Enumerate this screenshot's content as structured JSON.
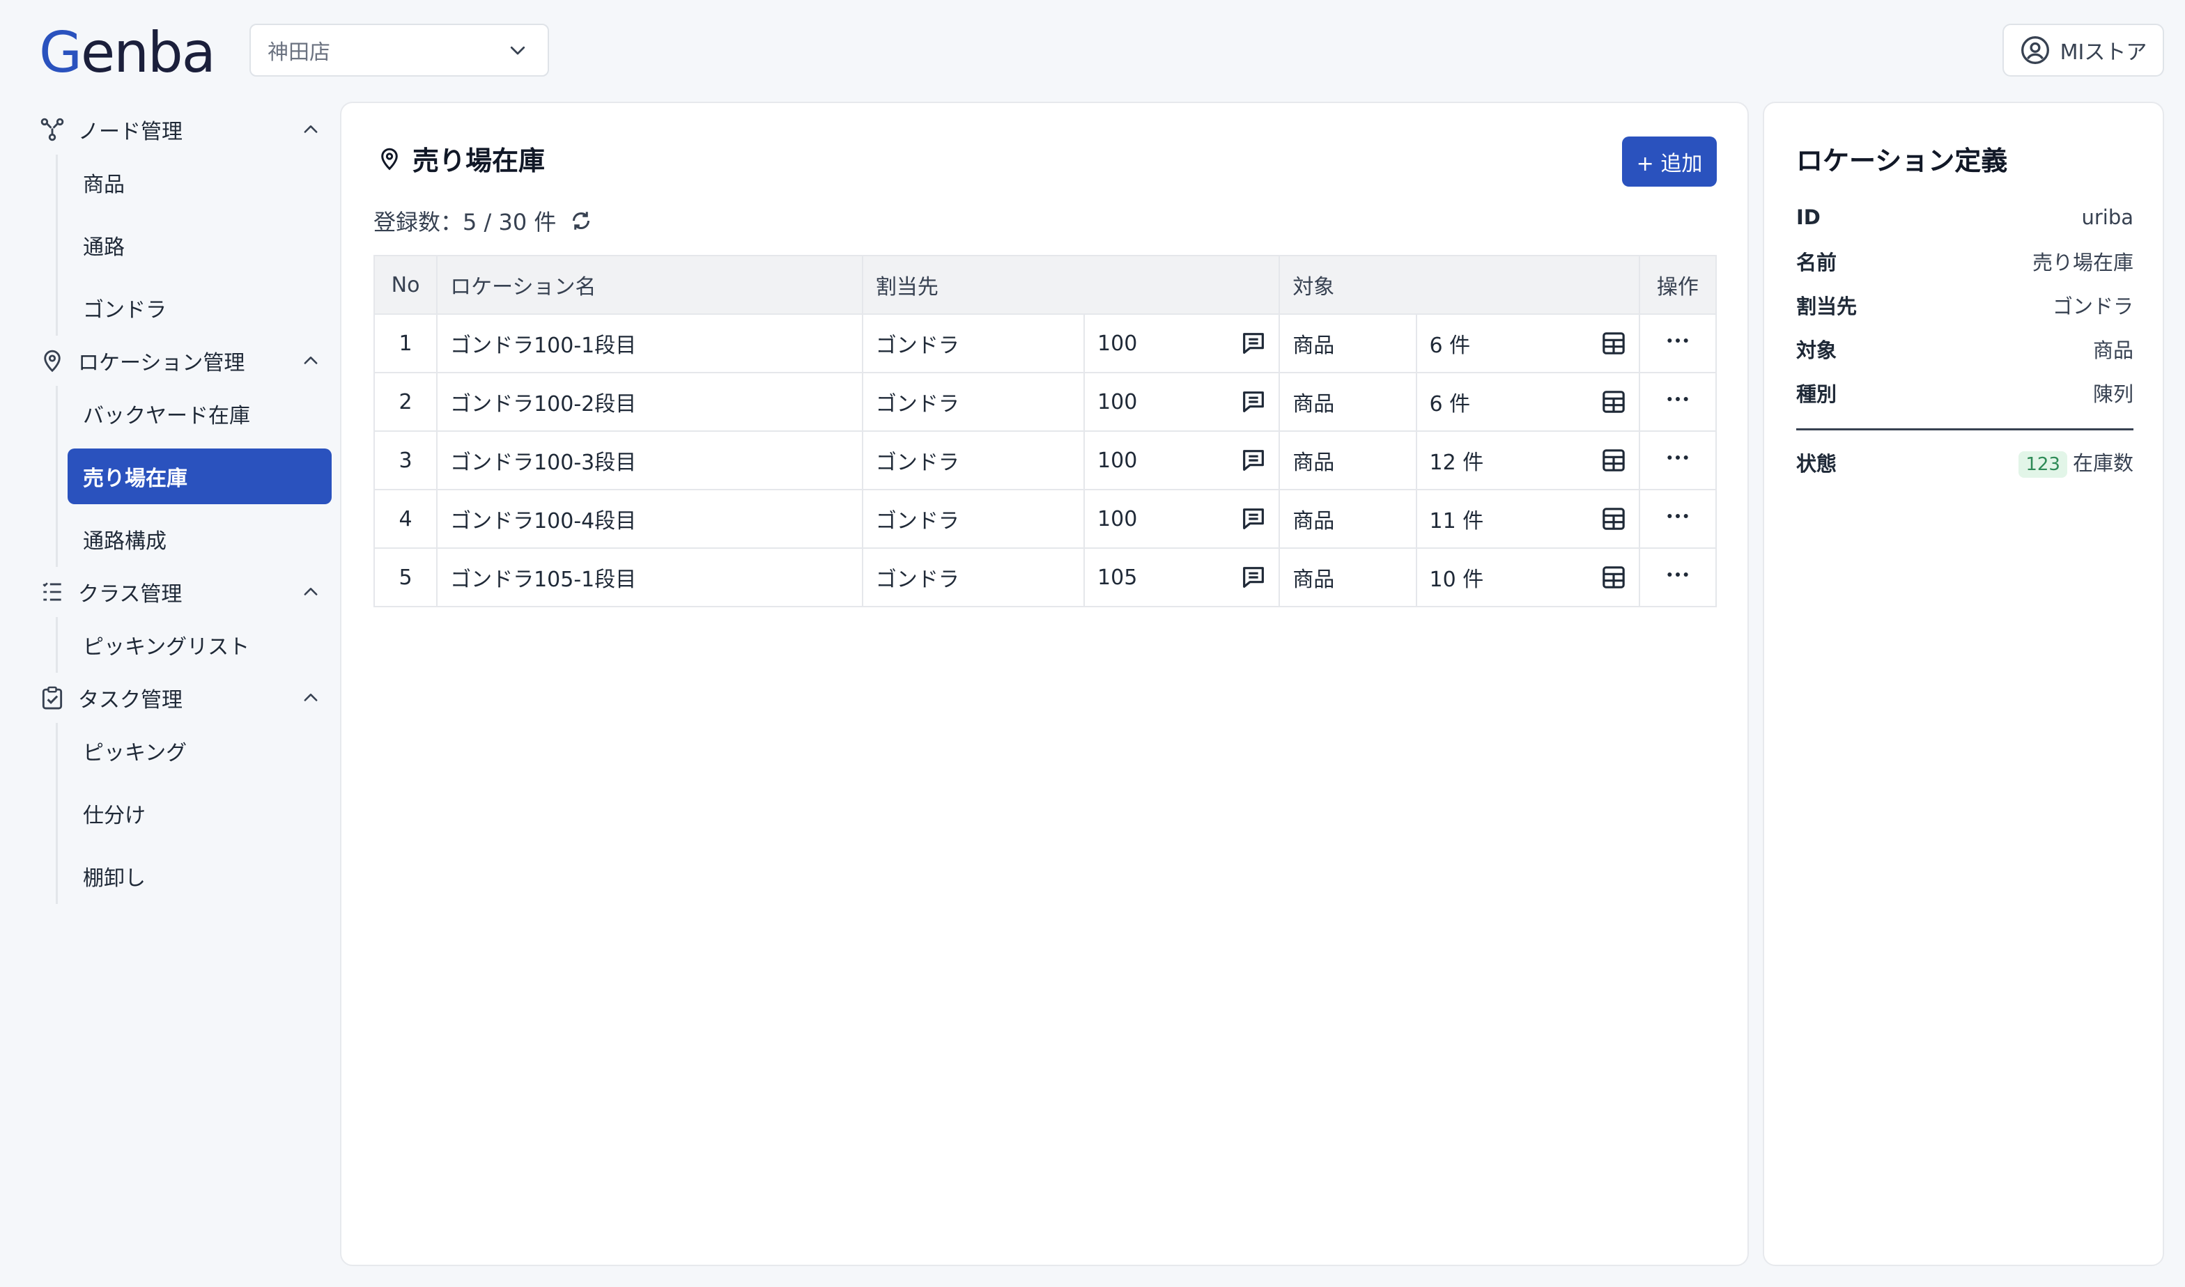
{
  "header": {
    "logo_g": "G",
    "logo_rest": "enba",
    "store_select_value": "神田店",
    "user_label": "MIストア"
  },
  "sidebar": {
    "groups": [
      {
        "label": "ノード管理",
        "icon": "node-icon",
        "items": [
          "商品",
          "通路",
          "ゴンドラ"
        ]
      },
      {
        "label": "ロケーション管理",
        "icon": "location-pin-icon",
        "items": [
          "バックヤード在庫",
          "売り場在庫",
          "通路構成"
        ],
        "active": "売り場在庫"
      },
      {
        "label": "クラス管理",
        "icon": "list-icon",
        "items": [
          "ピッキングリスト"
        ]
      },
      {
        "label": "タスク管理",
        "icon": "task-check-icon",
        "items": [
          "ピッキング",
          "仕分け",
          "棚卸し"
        ]
      }
    ]
  },
  "main": {
    "title": "売り場在庫",
    "add_label": "+ 追加",
    "count_text": "登録数：5 / 30 件",
    "table": {
      "headers": [
        "No",
        "ロケーション名",
        "割当先",
        "対象",
        "操作"
      ],
      "rows": [
        {
          "no": "1",
          "name": "ゴンドラ100-1段目",
          "assign": "ゴンドラ",
          "assign_id": "100",
          "target": "商品",
          "target_count": "6 件"
        },
        {
          "no": "2",
          "name": "ゴンドラ100-2段目",
          "assign": "ゴンドラ",
          "assign_id": "100",
          "target": "商品",
          "target_count": "6 件"
        },
        {
          "no": "3",
          "name": "ゴンドラ100-3段目",
          "assign": "ゴンドラ",
          "assign_id": "100",
          "target": "商品",
          "target_count": "12 件"
        },
        {
          "no": "4",
          "name": "ゴンドラ100-4段目",
          "assign": "ゴンドラ",
          "assign_id": "100",
          "target": "商品",
          "target_count": "11 件"
        },
        {
          "no": "5",
          "name": "ゴンドラ105-1段目",
          "assign": "ゴンドラ",
          "assign_id": "105",
          "target": "商品",
          "target_count": "10 件"
        }
      ]
    }
  },
  "definition": {
    "title": "ロケーション定義",
    "rows": [
      {
        "k": "ID",
        "v": "uriba"
      },
      {
        "k": "名前",
        "v": "売り場在庫"
      },
      {
        "k": "割当先",
        "v": "ゴンドラ"
      },
      {
        "k": "対象",
        "v": "商品"
      },
      {
        "k": "種別",
        "v": "陳列"
      }
    ],
    "status_label": "状態",
    "status_badge": "123",
    "status_value": "在庫数"
  },
  "colors": {
    "accent": "#2a52be",
    "badge_bg": "#e2f5e8",
    "badge_fg": "#2e8b57"
  }
}
